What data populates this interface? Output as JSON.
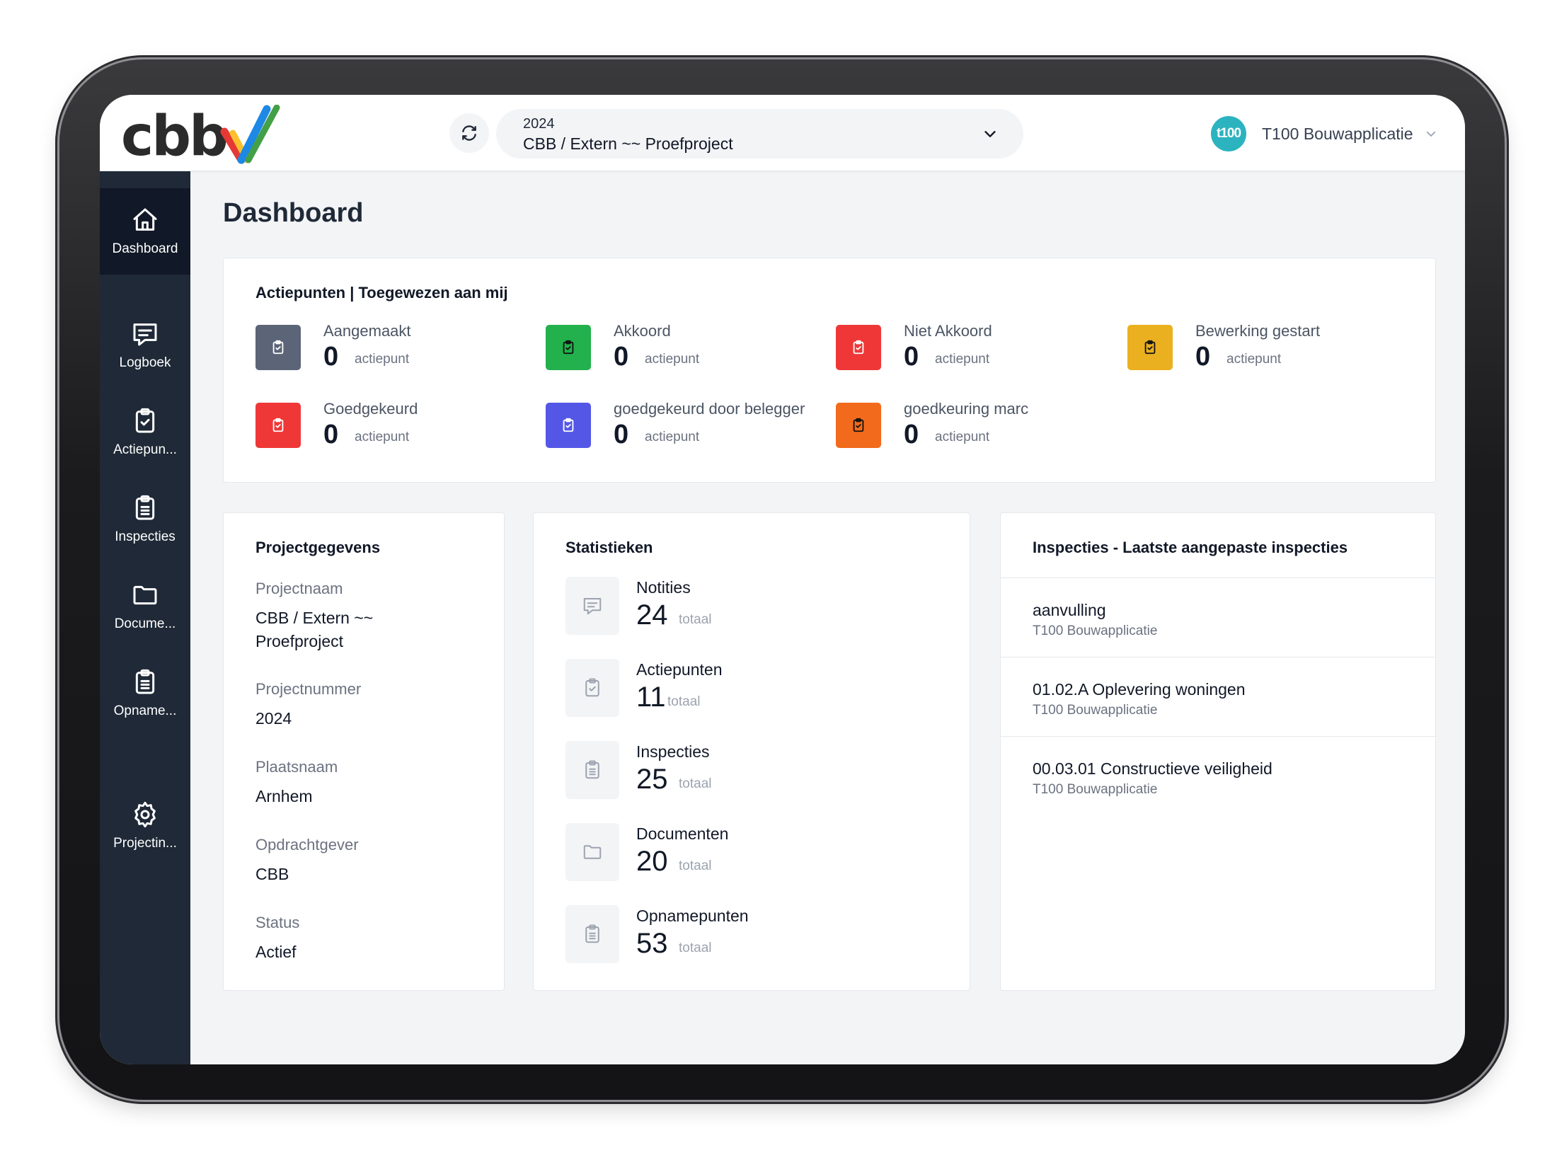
{
  "header": {
    "logo_text": "cbb",
    "project_year": "2024",
    "project_name": "CBB / Extern ~~ Proefproject",
    "user_initials": "t100",
    "user_name": "T100 Bouwapplicatie"
  },
  "sidebar": {
    "items": [
      {
        "label": "Dashboard",
        "icon": "home-icon"
      },
      {
        "label": "Logboek",
        "icon": "message-icon"
      },
      {
        "label": "Actiepun...",
        "icon": "clipboard-check-icon"
      },
      {
        "label": "Inspecties",
        "icon": "clipboard-list-icon"
      },
      {
        "label": "Docume...",
        "icon": "folder-icon"
      },
      {
        "label": "Opname...",
        "icon": "clipboard-list-icon"
      },
      {
        "label": "Projectin...",
        "icon": "gear-icon"
      }
    ]
  },
  "page": {
    "title": "Dashboard"
  },
  "actiepunten": {
    "title": "Actiepunten | Toegewezen aan mij",
    "items": [
      {
        "label": "Aangemaakt",
        "count": "0",
        "unit": "actiepunt",
        "color": "#5b6577"
      },
      {
        "label": "Akkoord",
        "count": "0",
        "unit": "actiepunt",
        "color": "#22b14c"
      },
      {
        "label": "Niet Akkoord",
        "count": "0",
        "unit": "actiepunt",
        "color": "#ef3737"
      },
      {
        "label": "Bewerking gestart",
        "count": "0",
        "unit": "actiepunt",
        "color": "#eab01f"
      },
      {
        "label": "Goedgekeurd",
        "count": "0",
        "unit": "actiepunt",
        "color": "#ef3737"
      },
      {
        "label": "goedgekeurd door belegger",
        "count": "0",
        "unit": "actiepunt",
        "color": "#5457e6"
      },
      {
        "label": "goedkeuring marc",
        "count": "0",
        "unit": "actiepunt",
        "color": "#f26a1b"
      }
    ]
  },
  "projectgegevens": {
    "title": "Projectgegevens",
    "fields": [
      {
        "label": "Projectnaam",
        "value": "CBB / Extern ~~ Proefproject"
      },
      {
        "label": "Projectnummer",
        "value": "2024"
      },
      {
        "label": "Plaatsnaam",
        "value": "Arnhem"
      },
      {
        "label": "Opdrachtgever",
        "value": "CBB"
      },
      {
        "label": "Status",
        "value": "Actief"
      }
    ]
  },
  "statistieken": {
    "title": "Statistieken",
    "items": [
      {
        "label": "Notities",
        "count": "24",
        "unit": "totaal",
        "icon": "message-icon"
      },
      {
        "label": "Actiepunten",
        "count": "11",
        "unit": "totaal",
        "icon": "clipboard-check-icon"
      },
      {
        "label": "Inspecties",
        "count": "25",
        "unit": "totaal",
        "icon": "clipboard-list-icon"
      },
      {
        "label": "Documenten",
        "count": "20",
        "unit": "totaal",
        "icon": "folder-icon"
      },
      {
        "label": "Opnamepunten",
        "count": "53",
        "unit": "totaal",
        "icon": "clipboard-list-icon"
      }
    ]
  },
  "inspecties": {
    "title": "Inspecties - Laatste aangepaste inspecties",
    "rows": [
      {
        "title": "aanvulling",
        "subtitle": "T100 Bouwapplicatie"
      },
      {
        "title": "01.02.A Oplevering woningen",
        "subtitle": "T100 Bouwapplicatie"
      },
      {
        "title": "00.03.01 Constructieve veiligheid",
        "subtitle": "T100 Bouwapplicatie"
      }
    ]
  }
}
